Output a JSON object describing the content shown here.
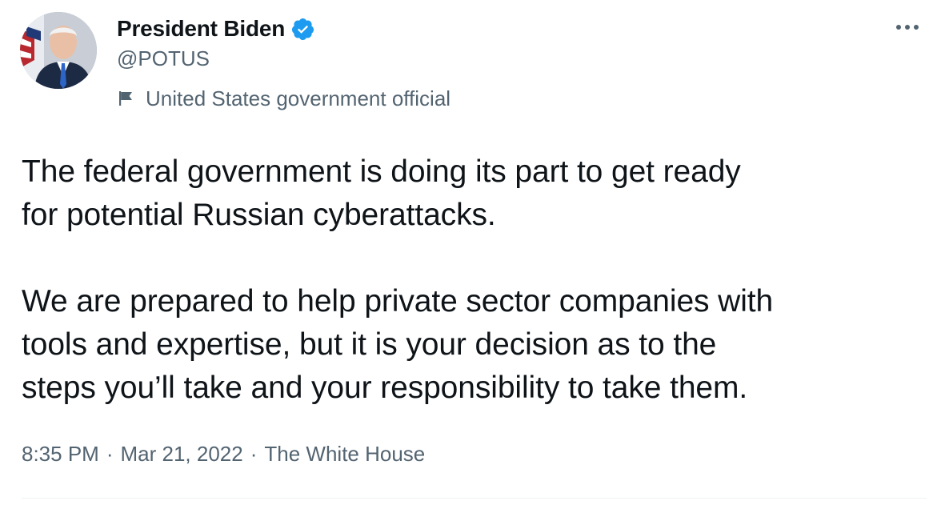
{
  "author": {
    "display_name": "President Biden",
    "handle": "@POTUS",
    "label": "United States government official",
    "avatar_icon": "portrait-photo",
    "verified_icon": "verified-badge-icon",
    "label_icon": "flag-icon"
  },
  "tweet": {
    "text": "The federal government is doing its part to get ready\nfor potential Russian cyberattacks.\n\nWe are prepared to help private sector companies with\ntools and expertise, but it is your decision as to the\nsteps you’ll take and your responsibility to take them.",
    "time": "8:35 PM",
    "date": "Mar 21, 2022",
    "source": "The White House",
    "separator": "·"
  },
  "colors": {
    "text": "#0f1419",
    "secondary": "#536471",
    "verified": "#1d9bf0",
    "divider": "#eff3f4"
  }
}
